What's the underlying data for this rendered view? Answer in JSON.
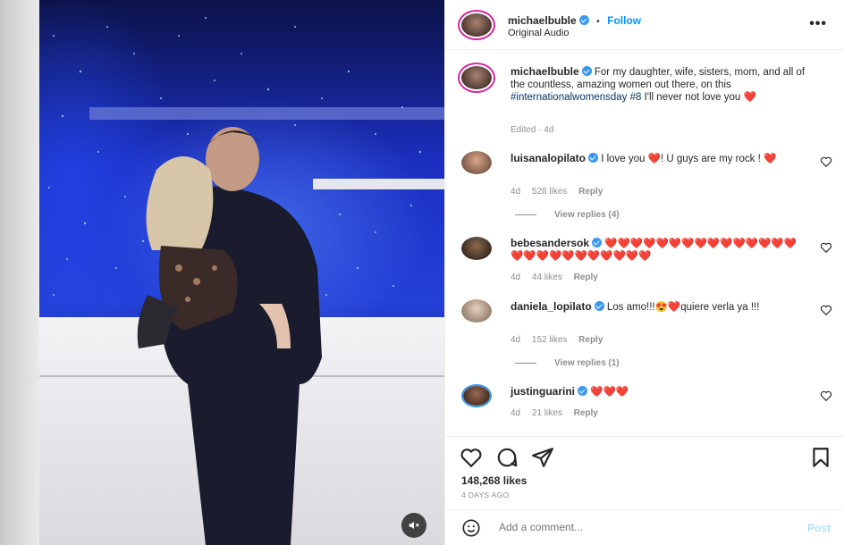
{
  "post": {
    "author": "michaelbuble",
    "follow_label": "Follow",
    "separator": "•",
    "audio": "Original Audio",
    "more_label": "•••",
    "caption": {
      "username": "michaelbuble",
      "text_before": "For my daughter, wife, sisters, mom, and all of the countless, amazing women out there, on this ",
      "hashtags": "#internationalwomensday #8",
      "text_after": " I'll never not love you ",
      "heart": "❤️",
      "meta": "Edited · 4d"
    },
    "comments": [
      {
        "username": "luisanalopilato",
        "text": "I love you ❤️! U guys are my rock ! ❤️",
        "age": "4d",
        "likes": "528 likes",
        "reply": "Reply",
        "view_replies": "View replies (4)"
      },
      {
        "username": "bebesandersok",
        "text": "❤️❤️❤️❤️❤️❤️❤️❤️❤️❤️❤️❤️❤️❤️❤️❤️❤️❤️❤️❤️❤️❤️❤️❤️❤️❤️",
        "age": "4d",
        "likes": "44 likes",
        "reply": "Reply"
      },
      {
        "username": "daniela_lopilato",
        "text": "Los amo!!!😍❤️quiere verla ya !!!",
        "age": "4d",
        "likes": "152 likes",
        "reply": "Reply",
        "view_replies": "View replies (1)"
      },
      {
        "username": "justinguarini",
        "text": "❤️❤️❤️",
        "age": "4d",
        "likes": "21 likes",
        "reply": "Reply"
      }
    ],
    "likes": "148,268 likes",
    "date": "4 DAYS AGO",
    "add_comment_placeholder": "Add a comment...",
    "post_label": "Post"
  },
  "icons": {
    "heart": "heart-outline-icon",
    "comment": "comment-bubble-icon",
    "share": "paper-plane-icon",
    "save": "bookmark-icon",
    "emoji": "smiley-icon",
    "mute": "speaker-muted-icon"
  },
  "colors": {
    "follow": "#0095f6",
    "verified": "#3897f0",
    "heart": "#ed4956",
    "post_disabled": "#b2dffc"
  }
}
